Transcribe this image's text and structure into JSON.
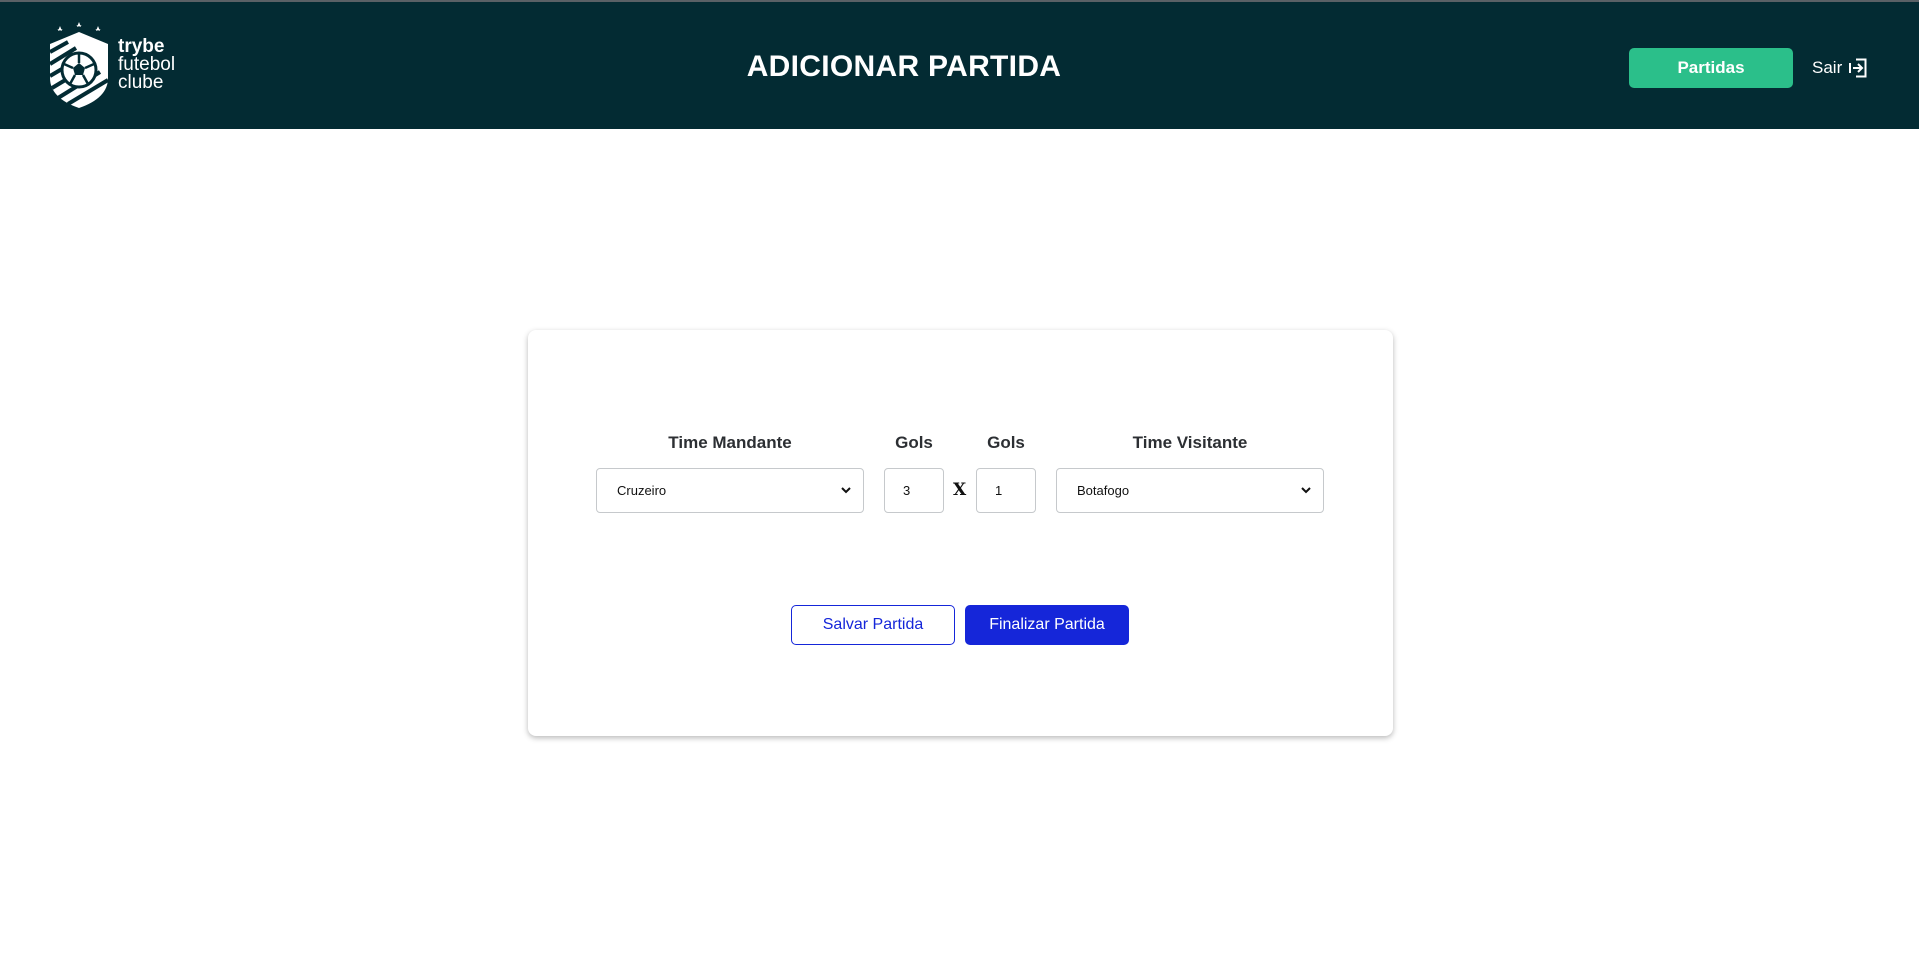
{
  "header": {
    "logo": {
      "line1": "trybe",
      "line2": "futebol",
      "line3": "clube",
      "icon": "soccer-ball-shield-icon"
    },
    "title": "ADICIONAR PARTIDA",
    "nav_button": "Partidas",
    "logout": {
      "label": "Sair",
      "icon": "logout-arrow-icon"
    }
  },
  "form": {
    "home_team": {
      "label": "Time Mandante",
      "selected": "Cruzeiro"
    },
    "home_goals": {
      "label": "Gols",
      "value": "3"
    },
    "versus": "X",
    "away_goals": {
      "label": "Gols",
      "value": "1"
    },
    "away_team": {
      "label": "Time Visitante",
      "selected": "Botafogo"
    }
  },
  "actions": {
    "save": "Salvar Partida",
    "finish": "Finalizar Partida"
  },
  "colors": {
    "header_bg": "#032b33",
    "accent_green": "#2bbf8a",
    "accent_blue": "#1526d9"
  }
}
